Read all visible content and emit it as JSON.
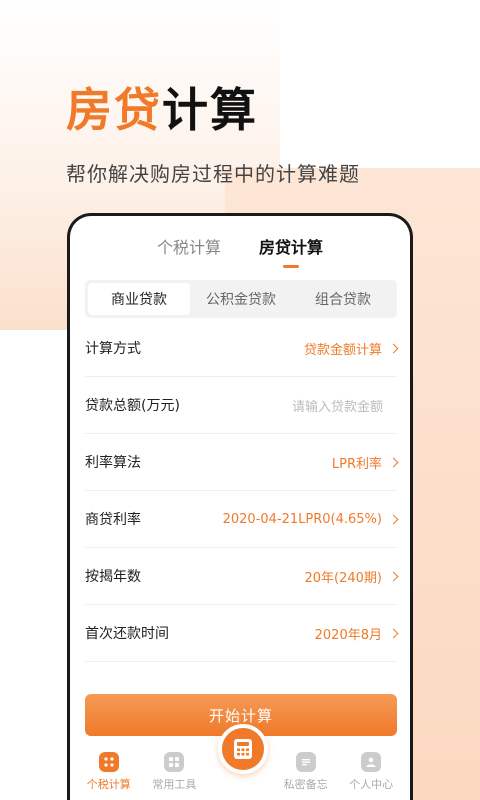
{
  "headline": {
    "accent": "房贷",
    "rest": "计算"
  },
  "subtitle": "帮你解决购房过程中的计算难题",
  "top_tabs": [
    {
      "label": "个税计算",
      "active": false
    },
    {
      "label": "房贷计算",
      "active": true
    }
  ],
  "segments": [
    {
      "label": "商业贷款",
      "active": true
    },
    {
      "label": "公积金贷款",
      "active": false
    },
    {
      "label": "组合贷款",
      "active": false
    }
  ],
  "form": {
    "calc_method": {
      "label": "计算方式",
      "value": "贷款金额计算"
    },
    "loan_total": {
      "label": "贷款总额(万元)",
      "placeholder": "请输入贷款金额"
    },
    "rate_method": {
      "label": "利率算法",
      "value": "LPR利率"
    },
    "commercial_rate": {
      "label": "商贷利率",
      "value": "2020-04-21LPR0(4.65%)"
    },
    "years": {
      "label": "按揭年数",
      "value": "20年(240期)"
    },
    "first_repay": {
      "label": "首次还款时间",
      "value": "2020年8月"
    }
  },
  "start_button": "开始计算",
  "tabbar": {
    "tax": "个税计算",
    "tools": "常用工具",
    "memo": "私密备忘",
    "profile": "个人中心"
  },
  "colors": {
    "accent": "#f07a2a"
  },
  "icons": {
    "tax": "grid-icon",
    "tools": "tools-icon",
    "center": "calculator-icon",
    "memo": "note-icon",
    "profile": "user-icon"
  }
}
